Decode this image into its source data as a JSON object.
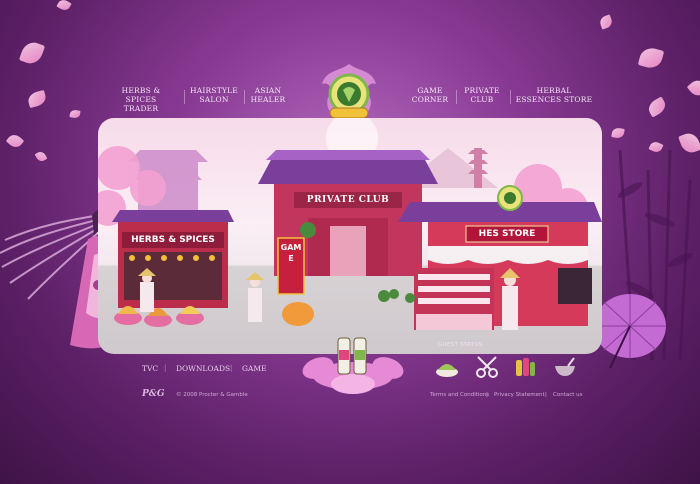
{
  "nav": {
    "items": [
      {
        "line1": "HERBS & SPICES",
        "line2": "TRADER"
      },
      {
        "line1": "HAIRSTYLE",
        "line2": "SALON"
      },
      {
        "line1": "ASIAN",
        "line2": "HEALER"
      },
      {
        "line1": "GAME",
        "line2": "CORNER"
      },
      {
        "line1": "PRIVATE",
        "line2": "CLUB"
      },
      {
        "line1": "HERBAL",
        "line2": "ESSENCES STORE"
      }
    ]
  },
  "scene": {
    "private_club_sign": "PRIVATE CLUB",
    "herbs_sign": "HERBS & SPICES",
    "game_sign": "GAME",
    "hes_store_sign": "HES STORE"
  },
  "guest_status": {
    "label": "GUEST STATUS"
  },
  "footer": {
    "links": [
      "TVC",
      "DOWNLOADS",
      "GAME"
    ],
    "brand": "P&G",
    "copyright": "© 2008 Procter & Gamble",
    "legal": [
      "Terms and Conditions",
      "Privacy Statement",
      "Contact us"
    ]
  },
  "colors": {
    "background": "#5c2066",
    "accent": "#e0457d",
    "roof": "#7a3f9a"
  }
}
